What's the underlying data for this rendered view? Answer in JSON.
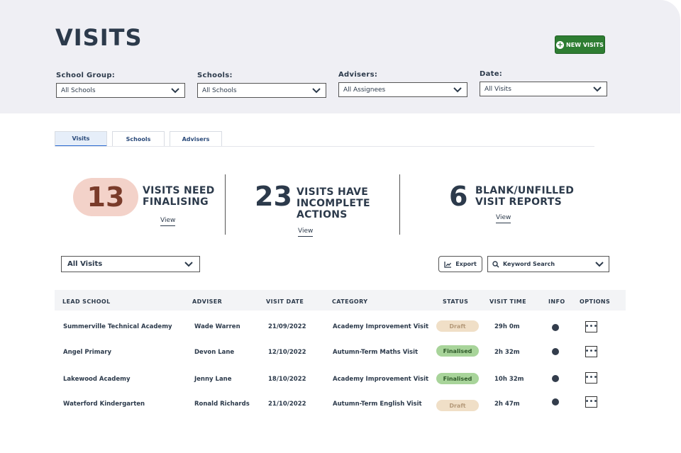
{
  "header": {
    "title": "VISITS",
    "new_button_label": "NEW VISITS"
  },
  "filters": [
    {
      "label": "School Group:",
      "value": "All Schools"
    },
    {
      "label": "Schools:",
      "value": "All Schools"
    },
    {
      "label": "Advisers:",
      "value": "All Assignees"
    },
    {
      "label": "Date:",
      "value": "All Visits"
    }
  ],
  "tabs": [
    "Visits",
    "Schools",
    "Advisers"
  ],
  "stats": [
    {
      "number": "13",
      "line1": "VISITS NEED",
      "line2": "FINALISING",
      "line3": "",
      "view": "View"
    },
    {
      "number": "23",
      "line1": "VISITS HAVE",
      "line2": "INCOMPLETE",
      "line3": "ACTIONS",
      "view": "View"
    },
    {
      "number": "6",
      "line1": "BLANK/UNFILLED",
      "line2": "VISIT REPORTS",
      "line3": "",
      "view": "View"
    }
  ],
  "toolbar": {
    "visits_select": "All Visits",
    "export_label": "Export",
    "search_placeholder": "Keyword Search"
  },
  "table": {
    "columns": [
      "LEAD SCHOOL",
      "ADVISER",
      "VISIT DATE",
      "CATEGORY",
      "STATUS",
      "VISIT TIME",
      "INFO",
      "OPTIONS"
    ],
    "rows": [
      {
        "school": "Summerville Technical Academy",
        "adviser": "Wade Warren",
        "date": "21/09/2022",
        "category": "Academy Improvement Visit",
        "status": "Draft",
        "time": "29h 0m"
      },
      {
        "school": "Angel Primary",
        "adviser": "Devon Lane",
        "date": "12/10/2022",
        "category": "Autumn-Term Maths Visit",
        "status": "Finalised",
        "time": "2h 32m"
      },
      {
        "school": "Lakewood Academy",
        "adviser": "Jenny Lane",
        "date": "18/10/2022",
        "category": "Academy Improvement Visit",
        "status": "Finalised",
        "time": "10h 32m"
      },
      {
        "school": "Waterford Kindergarten",
        "adviser": "Ronald Richards",
        "date": "21/10/2022",
        "category": "Autumn-Term English Visit",
        "status": "Draft",
        "time": "2h 47m"
      }
    ]
  },
  "colors": {
    "brand_green": "#2e7d32",
    "accent_pill": "#f3d2c9",
    "draft_badge": "#f0dfc7",
    "finalised_badge": "#a8d49a"
  }
}
